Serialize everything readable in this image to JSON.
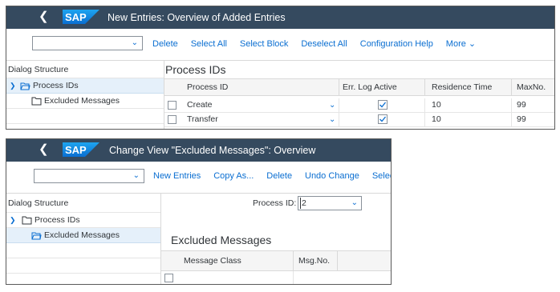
{
  "window1": {
    "title": "New Entries: Overview of Added Entries",
    "toolbar": {
      "items": [
        "Delete",
        "Select All",
        "Select Block",
        "Deselect All",
        "Configuration Help",
        "More"
      ]
    },
    "nav": {
      "header": "Dialog Structure",
      "items": [
        {
          "label": "Process IDs",
          "selected": true
        },
        {
          "label": "Excluded Messages",
          "selected": false
        }
      ]
    },
    "section_title": "Process IDs",
    "table": {
      "columns": [
        "Process ID",
        "Err. Log Active",
        "Residence Time",
        "MaxNo."
      ],
      "rows": [
        {
          "process_id": "Create",
          "err_log_active": true,
          "residence_time": "10",
          "max_no": "99"
        },
        {
          "process_id": "Transfer",
          "err_log_active": true,
          "residence_time": "10",
          "max_no": "99"
        }
      ]
    }
  },
  "window2": {
    "title": "Change View \"Excluded Messages\": Overview",
    "toolbar": {
      "items": [
        "New Entries",
        "Copy As...",
        "Delete",
        "Undo Change",
        "Select All"
      ]
    },
    "nav": {
      "header": "Dialog Structure",
      "items": [
        {
          "label": "Process IDs",
          "selected": false
        },
        {
          "label": "Excluded Messages",
          "selected": true
        }
      ]
    },
    "process_id_label": "Process ID:",
    "process_id_value": "2",
    "section_title": "Excluded Messages",
    "table": {
      "columns": [
        "Message Class",
        "Msg.No."
      ]
    }
  },
  "icons": {
    "back": "chevron-left-icon",
    "logo": "sap-logo",
    "dropdown": "chevron-down-icon",
    "folder": "folder-icon",
    "folder_open": "folder-open-icon",
    "checkbox": "checkbox-checked-icon"
  },
  "colors": {
    "shell_bar": "#354a5f",
    "link": "#0a6ed1",
    "selection": "#e5f0fa"
  }
}
